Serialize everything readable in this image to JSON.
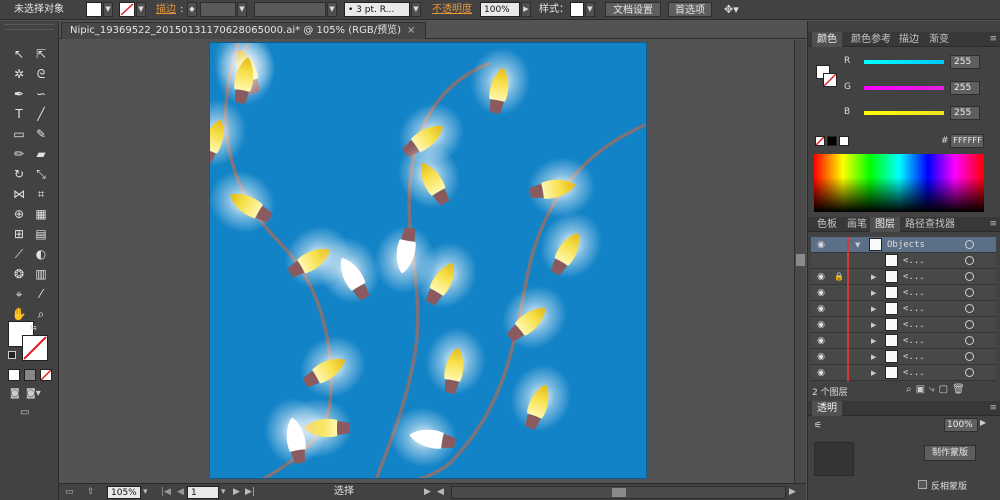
{
  "control_bar": {
    "selection_status": "未选择对象",
    "stroke_link": "描边",
    "stroke_weight": "",
    "brush_preset": "• 3 pt. R...",
    "opacity_link": "不透明度",
    "opacity_value": "100%",
    "style_label": "样式：",
    "document_setup": "文档设置",
    "preferences": "首选项"
  },
  "document_tab": {
    "title": "Nipic_19369522_20150131170628065000.ai* @ 105% (RGB/预览)",
    "close": "×"
  },
  "status_bar": {
    "zoom": "105%",
    "artboard_number": "1",
    "tool_status": "选择"
  },
  "color_panel": {
    "tabs": [
      "颜色",
      "颜色参考",
      "描边",
      "渐变"
    ],
    "channels": [
      {
        "label": "R",
        "value": "255",
        "color": "#00c8ff"
      },
      {
        "label": "G",
        "value": "255",
        "color": "#e020e0"
      },
      {
        "label": "B",
        "value": "255",
        "color": "#f0e020"
      }
    ],
    "hex_label": "#",
    "hex_value": "FFFFFF"
  },
  "layers_panel": {
    "tabs": [
      "色板",
      "画笔",
      "图层",
      "路径查找器"
    ],
    "top_layer": "Objects",
    "rows": [
      "<...",
      "<...",
      "<...",
      "<...",
      "<...",
      "<...",
      "<...",
      "<..."
    ],
    "layer_count": "2 个图层"
  },
  "transparency_panel": {
    "tab": "透明",
    "opacity": "100%",
    "mask_button": "制作蒙版",
    "invert_mask": "反相蒙版"
  },
  "colors": {
    "artboard": "#1283c7",
    "cord": "#7d7378",
    "bulb_yellow": "#f5dc3c",
    "socket": "#8a5a5e"
  }
}
